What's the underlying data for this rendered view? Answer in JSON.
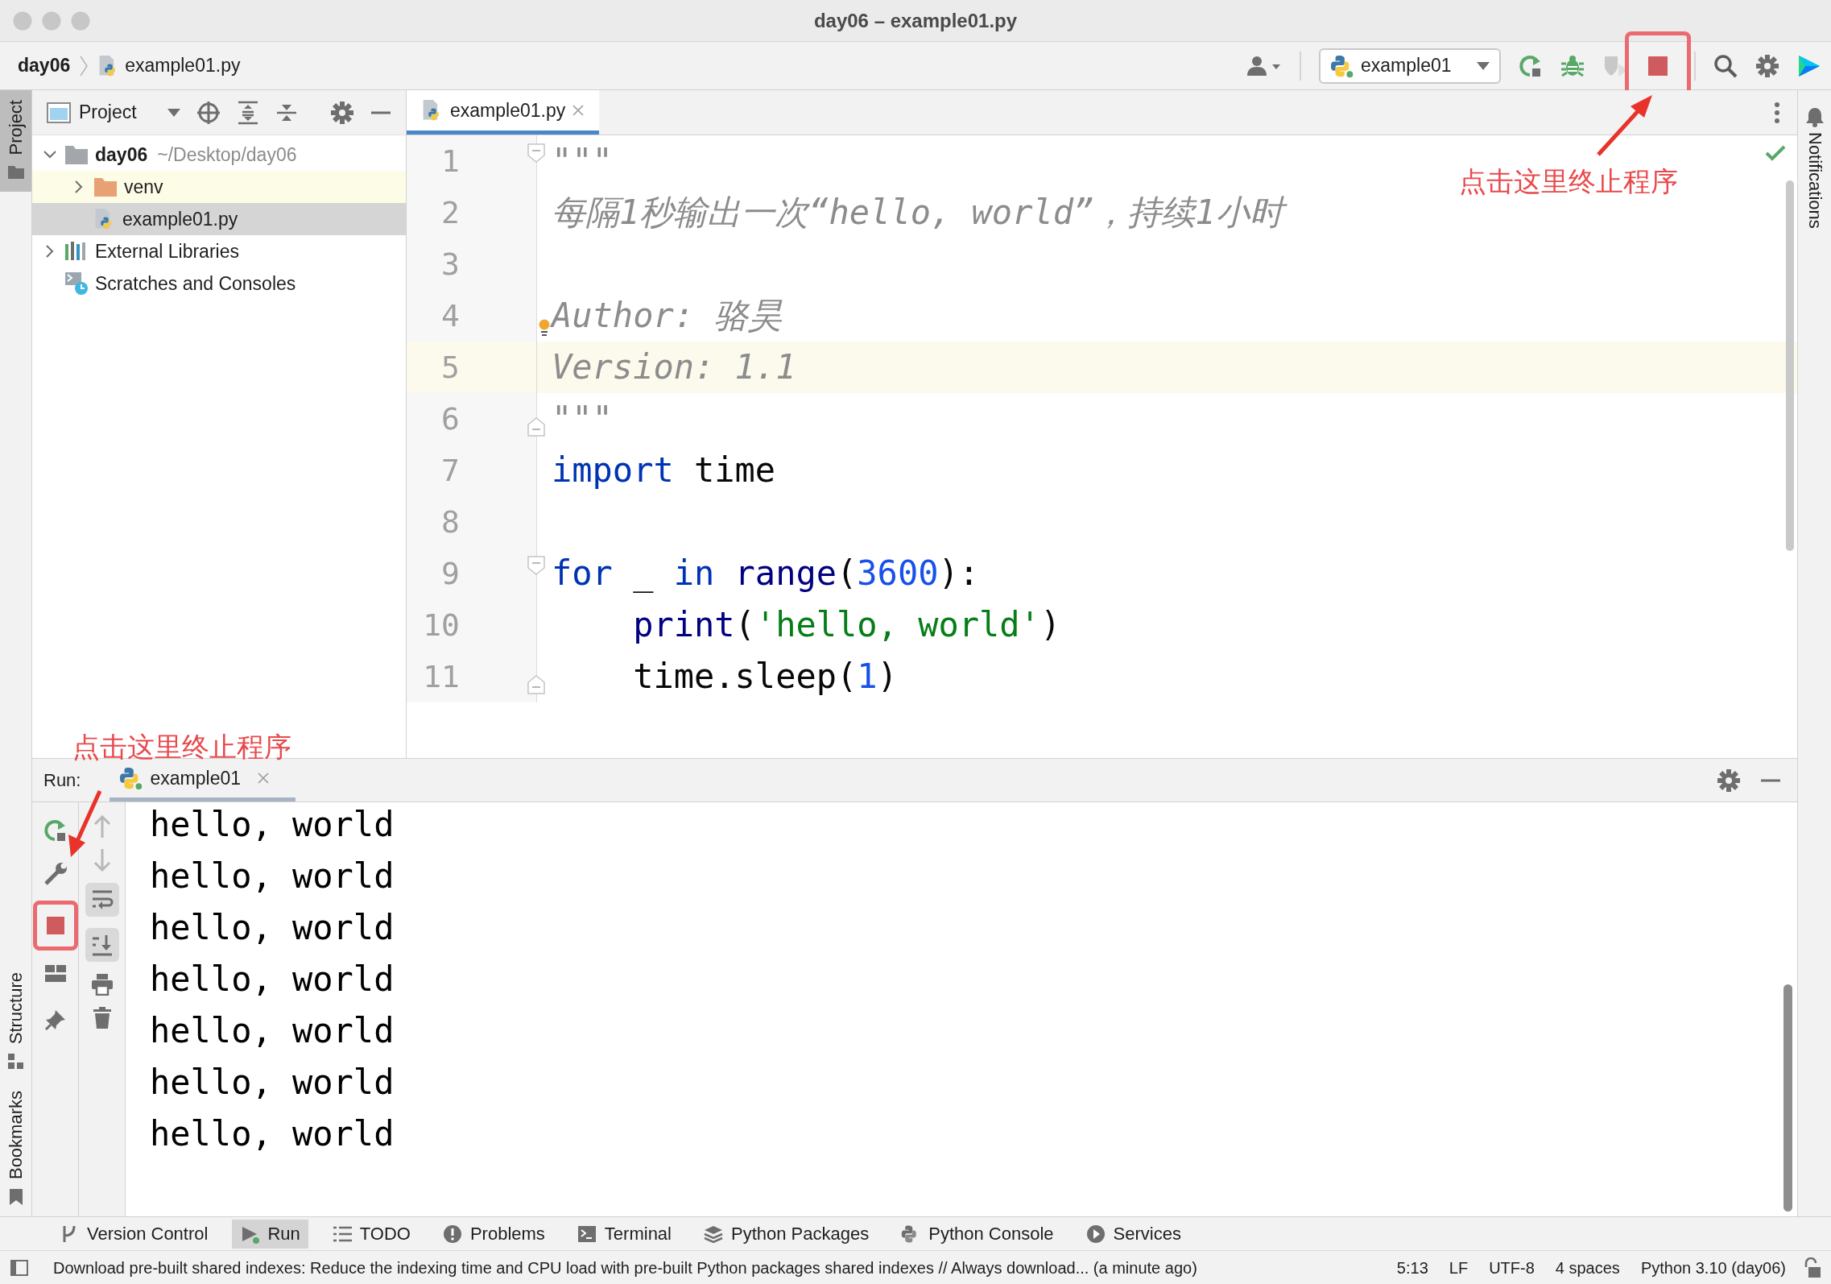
{
  "window": {
    "title": "day06 – example01.py"
  },
  "breadcrumb": [
    "day06",
    "example01.py"
  ],
  "run_config": {
    "label": "example01"
  },
  "left_strip": [
    {
      "label": "Project",
      "selected": true
    },
    {
      "label": "Structure",
      "selected": false
    },
    {
      "label": "Bookmarks",
      "selected": false
    }
  ],
  "right_strip": [
    {
      "label": "Notifications"
    }
  ],
  "project_panel": {
    "title": "Project",
    "tree": [
      {
        "kind": "root",
        "label": "day06",
        "path": "~/Desktop/day06",
        "expanded": true,
        "selected": false,
        "children": [
          {
            "kind": "excluded-folder",
            "label": "venv",
            "expanded": false,
            "selected": false
          },
          {
            "kind": "python-file",
            "label": "example01.py",
            "selected": true
          }
        ]
      },
      {
        "kind": "libraries",
        "label": "External Libraries",
        "expanded": false,
        "selected": false
      },
      {
        "kind": "scratches",
        "label": "Scratches and Consoles",
        "selected": false
      }
    ]
  },
  "editor": {
    "tabs": [
      {
        "label": "example01.py",
        "selected": true
      }
    ],
    "lines": [
      {
        "number": "1",
        "current": false,
        "fold_open": true,
        "fold_close": false,
        "bulb": false,
        "tokens": [
          {
            "kind": "doc",
            "text": "\"\"\""
          }
        ]
      },
      {
        "number": "2",
        "current": false,
        "fold_open": false,
        "fold_close": false,
        "bulb": false,
        "tokens": [
          {
            "kind": "doc",
            "text": "每隔1秒输出一次“hello, world”，持续1小时"
          }
        ]
      },
      {
        "number": "3",
        "current": false,
        "fold_open": false,
        "fold_close": false,
        "bulb": false
      },
      {
        "number": "4",
        "current": false,
        "fold_open": false,
        "fold_close": false,
        "bulb": true,
        "tokens": [
          {
            "kind": "doc",
            "text": "Author: 骆昊"
          }
        ]
      },
      {
        "number": "5",
        "current": true,
        "fold_open": false,
        "fold_close": false,
        "bulb": false,
        "tokens": [
          {
            "kind": "doc",
            "text": "Version: 1.1"
          }
        ]
      },
      {
        "number": "6",
        "current": false,
        "fold_open": false,
        "fold_close": true,
        "bulb": false,
        "tokens": [
          {
            "kind": "doc",
            "text": "\"\"\""
          }
        ]
      },
      {
        "number": "7",
        "current": false,
        "fold_open": false,
        "fold_close": false,
        "bulb": false,
        "tokens": [
          {
            "kind": "keyword",
            "text": "import"
          },
          {
            "kind": "plain",
            "text": " time"
          }
        ]
      },
      {
        "number": "8",
        "current": false,
        "fold_open": false,
        "fold_close": false,
        "bulb": false
      },
      {
        "number": "9",
        "current": false,
        "fold_open": true,
        "fold_close": false,
        "bulb": false,
        "tokens": [
          {
            "kind": "keyword",
            "text": "for"
          },
          {
            "kind": "plain",
            "text": " _ "
          },
          {
            "kind": "keyword",
            "text": "in"
          },
          {
            "kind": "builtin",
            "text": " range"
          },
          {
            "kind": "plain",
            "text": "("
          },
          {
            "kind": "number",
            "text": "3600"
          },
          {
            "kind": "plain",
            "text": "):"
          }
        ]
      },
      {
        "number": "10",
        "current": false,
        "fold_open": false,
        "fold_close": false,
        "bulb": false,
        "tokens": [
          {
            "kind": "builtin",
            "text": "    print"
          },
          {
            "kind": "plain",
            "text": "("
          },
          {
            "kind": "string",
            "text": "'hello, world'"
          },
          {
            "kind": "plain",
            "text": ")"
          }
        ]
      },
      {
        "number": "11",
        "current": false,
        "fold_open": false,
        "fold_close": true,
        "bulb": false,
        "tokens": [
          {
            "kind": "plain",
            "text": "    time.sleep("
          },
          {
            "kind": "number",
            "text": "1"
          },
          {
            "kind": "plain",
            "text": ")"
          }
        ]
      }
    ]
  },
  "run_panel": {
    "label": "Run:",
    "tabs": [
      {
        "label": "example01",
        "selected": true
      }
    ],
    "output": [
      "hello, world",
      "hello, world",
      "hello, world",
      "hello, world",
      "hello, world",
      "hello, world",
      "hello, world"
    ]
  },
  "annotations": [
    {
      "text": "点击这里终止程序"
    },
    {
      "text": "点击这里终止程序"
    }
  ],
  "tool_tabs": [
    {
      "label": "Version Control",
      "selected": false
    },
    {
      "label": "Run",
      "selected": true
    },
    {
      "label": "TODO",
      "selected": false
    },
    {
      "label": "Problems",
      "selected": false
    },
    {
      "label": "Terminal",
      "selected": false
    },
    {
      "label": "Python Packages",
      "selected": false
    },
    {
      "label": "Python Console",
      "selected": false
    },
    {
      "label": "Services",
      "selected": false
    }
  ],
  "status_bar": {
    "message": "Download pre-built shared indexes: Reduce the indexing time and CPU load with pre-built Python packages shared indexes // Always download... (a minute ago)",
    "items": [
      "5:13",
      "LF",
      "UTF-8",
      "4 spaces",
      "Python 3.10 (day06)"
    ]
  }
}
